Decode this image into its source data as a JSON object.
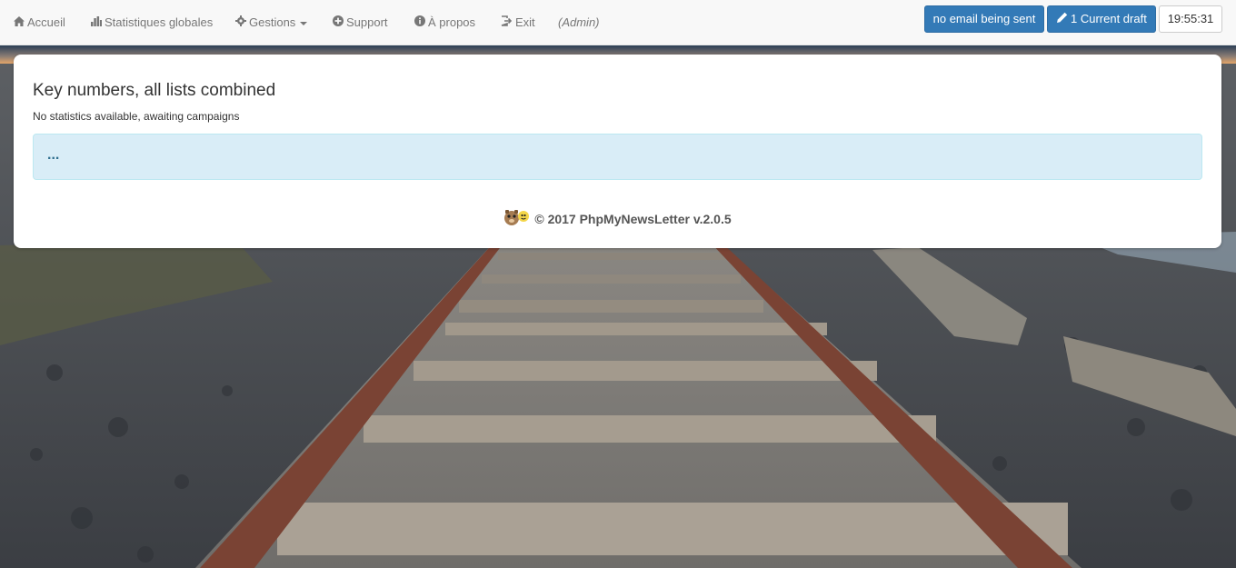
{
  "nav": {
    "home_label": "Accueil",
    "stats_label": "Statistiques globales",
    "manage_label": "Gestions",
    "support_label": "Support",
    "about_label": "À propos",
    "exit_label": "Exit",
    "role_label": "(Admin)"
  },
  "actions": {
    "email_status_label": "no email being sent",
    "draft_label": "1 Current draft",
    "clock": "19:55:31"
  },
  "panel": {
    "title": "Key numbers, all lists combined",
    "subtitle": "No statistics available, awaiting campaigns",
    "alert_text": "...",
    "footer_text": "© 2017 PhpMyNewsLetter v.2.0.5"
  },
  "colors": {
    "primary": "#337ab7",
    "info_bg": "#d9edf7",
    "info_text": "#31708f",
    "nav_bg": "#f8f8f8"
  },
  "icons": {
    "home": "home-icon",
    "stats": "bar-chart-icon",
    "manage": "gear-icon",
    "support": "plus-circle-icon",
    "about": "info-circle-icon",
    "exit": "exit-icon",
    "draft": "pencil-icon",
    "logo": "phpmynewsletter-logo"
  }
}
